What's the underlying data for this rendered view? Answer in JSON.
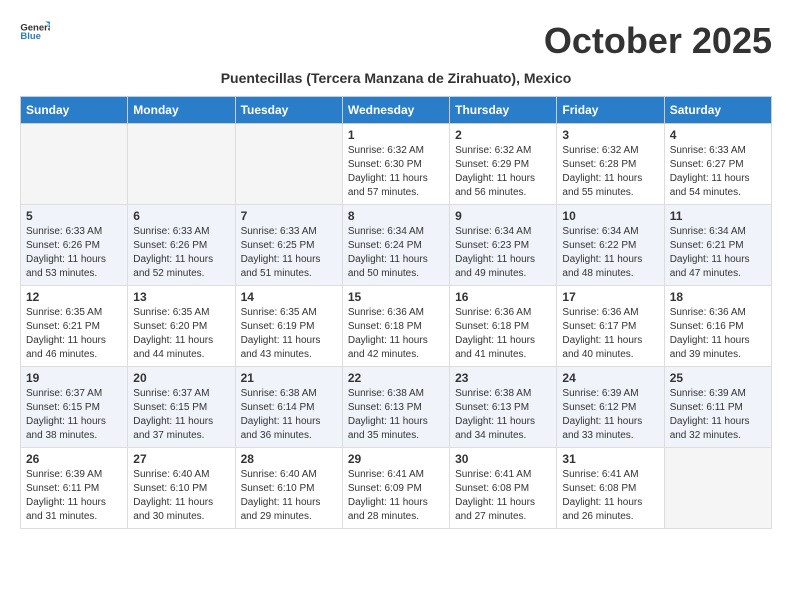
{
  "header": {
    "logo_general": "General",
    "logo_blue": "Blue",
    "month_title": "October 2025",
    "subtitle": "Puentecillas (Tercera Manzana de Zirahuato), Mexico"
  },
  "columns": [
    "Sunday",
    "Monday",
    "Tuesday",
    "Wednesday",
    "Thursday",
    "Friday",
    "Saturday"
  ],
  "weeks": [
    {
      "row": 1,
      "days": [
        {
          "num": "",
          "info": ""
        },
        {
          "num": "",
          "info": ""
        },
        {
          "num": "",
          "info": ""
        },
        {
          "num": "1",
          "info": "Sunrise: 6:32 AM\nSunset: 6:30 PM\nDaylight: 11 hours and 57 minutes."
        },
        {
          "num": "2",
          "info": "Sunrise: 6:32 AM\nSunset: 6:29 PM\nDaylight: 11 hours and 56 minutes."
        },
        {
          "num": "3",
          "info": "Sunrise: 6:32 AM\nSunset: 6:28 PM\nDaylight: 11 hours and 55 minutes."
        },
        {
          "num": "4",
          "info": "Sunrise: 6:33 AM\nSunset: 6:27 PM\nDaylight: 11 hours and 54 minutes."
        }
      ]
    },
    {
      "row": 2,
      "days": [
        {
          "num": "5",
          "info": "Sunrise: 6:33 AM\nSunset: 6:26 PM\nDaylight: 11 hours and 53 minutes."
        },
        {
          "num": "6",
          "info": "Sunrise: 6:33 AM\nSunset: 6:26 PM\nDaylight: 11 hours and 52 minutes."
        },
        {
          "num": "7",
          "info": "Sunrise: 6:33 AM\nSunset: 6:25 PM\nDaylight: 11 hours and 51 minutes."
        },
        {
          "num": "8",
          "info": "Sunrise: 6:34 AM\nSunset: 6:24 PM\nDaylight: 11 hours and 50 minutes."
        },
        {
          "num": "9",
          "info": "Sunrise: 6:34 AM\nSunset: 6:23 PM\nDaylight: 11 hours and 49 minutes."
        },
        {
          "num": "10",
          "info": "Sunrise: 6:34 AM\nSunset: 6:22 PM\nDaylight: 11 hours and 48 minutes."
        },
        {
          "num": "11",
          "info": "Sunrise: 6:34 AM\nSunset: 6:21 PM\nDaylight: 11 hours and 47 minutes."
        }
      ]
    },
    {
      "row": 3,
      "days": [
        {
          "num": "12",
          "info": "Sunrise: 6:35 AM\nSunset: 6:21 PM\nDaylight: 11 hours and 46 minutes."
        },
        {
          "num": "13",
          "info": "Sunrise: 6:35 AM\nSunset: 6:20 PM\nDaylight: 11 hours and 44 minutes."
        },
        {
          "num": "14",
          "info": "Sunrise: 6:35 AM\nSunset: 6:19 PM\nDaylight: 11 hours and 43 minutes."
        },
        {
          "num": "15",
          "info": "Sunrise: 6:36 AM\nSunset: 6:18 PM\nDaylight: 11 hours and 42 minutes."
        },
        {
          "num": "16",
          "info": "Sunrise: 6:36 AM\nSunset: 6:18 PM\nDaylight: 11 hours and 41 minutes."
        },
        {
          "num": "17",
          "info": "Sunrise: 6:36 AM\nSunset: 6:17 PM\nDaylight: 11 hours and 40 minutes."
        },
        {
          "num": "18",
          "info": "Sunrise: 6:36 AM\nSunset: 6:16 PM\nDaylight: 11 hours and 39 minutes."
        }
      ]
    },
    {
      "row": 4,
      "days": [
        {
          "num": "19",
          "info": "Sunrise: 6:37 AM\nSunset: 6:15 PM\nDaylight: 11 hours and 38 minutes."
        },
        {
          "num": "20",
          "info": "Sunrise: 6:37 AM\nSunset: 6:15 PM\nDaylight: 11 hours and 37 minutes."
        },
        {
          "num": "21",
          "info": "Sunrise: 6:38 AM\nSunset: 6:14 PM\nDaylight: 11 hours and 36 minutes."
        },
        {
          "num": "22",
          "info": "Sunrise: 6:38 AM\nSunset: 6:13 PM\nDaylight: 11 hours and 35 minutes."
        },
        {
          "num": "23",
          "info": "Sunrise: 6:38 AM\nSunset: 6:13 PM\nDaylight: 11 hours and 34 minutes."
        },
        {
          "num": "24",
          "info": "Sunrise: 6:39 AM\nSunset: 6:12 PM\nDaylight: 11 hours and 33 minutes."
        },
        {
          "num": "25",
          "info": "Sunrise: 6:39 AM\nSunset: 6:11 PM\nDaylight: 11 hours and 32 minutes."
        }
      ]
    },
    {
      "row": 5,
      "days": [
        {
          "num": "26",
          "info": "Sunrise: 6:39 AM\nSunset: 6:11 PM\nDaylight: 11 hours and 31 minutes."
        },
        {
          "num": "27",
          "info": "Sunrise: 6:40 AM\nSunset: 6:10 PM\nDaylight: 11 hours and 30 minutes."
        },
        {
          "num": "28",
          "info": "Sunrise: 6:40 AM\nSunset: 6:10 PM\nDaylight: 11 hours and 29 minutes."
        },
        {
          "num": "29",
          "info": "Sunrise: 6:41 AM\nSunset: 6:09 PM\nDaylight: 11 hours and 28 minutes."
        },
        {
          "num": "30",
          "info": "Sunrise: 6:41 AM\nSunset: 6:08 PM\nDaylight: 11 hours and 27 minutes."
        },
        {
          "num": "31",
          "info": "Sunrise: 6:41 AM\nSunset: 6:08 PM\nDaylight: 11 hours and 26 minutes."
        },
        {
          "num": "",
          "info": ""
        }
      ]
    }
  ]
}
